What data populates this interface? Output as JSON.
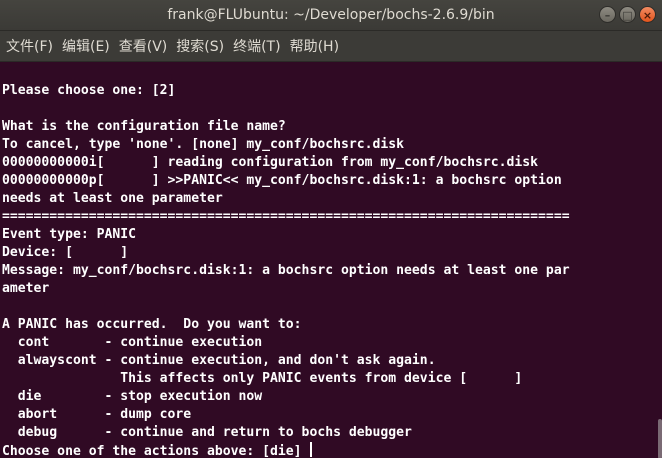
{
  "window": {
    "title": "frank@FLUbuntu: ~/Developer/bochs-2.6.9/bin",
    "buttons": {
      "minimize": "–",
      "maximize": "□",
      "close": "×"
    }
  },
  "menubar": {
    "items": [
      {
        "label": "文件(F)"
      },
      {
        "label": "编辑(E)"
      },
      {
        "label": "查看(V)"
      },
      {
        "label": "搜索(S)"
      },
      {
        "label": "终端(T)"
      },
      {
        "label": "帮助(H)"
      }
    ]
  },
  "terminal": {
    "lines": [
      "",
      "Please choose one: [2]",
      "",
      "What is the configuration file name?",
      "To cancel, type 'none'. [none] my_conf/bochsrc.disk",
      "00000000000i[      ] reading configuration from my_conf/bochsrc.disk",
      "00000000000p[      ] >>PANIC<< my_conf/bochsrc.disk:1: a bochsrc option",
      "needs at least one parameter",
      "========================================================================",
      "Event type: PANIC",
      "Device: [      ]",
      "Message: my_conf/bochsrc.disk:1: a bochsrc option needs at least one par",
      "ameter",
      "",
      "A PANIC has occurred.  Do you want to:",
      "  cont       - continue execution",
      "  alwayscont - continue execution, and don't ask again.",
      "               This affects only PANIC events from device [      ]",
      "  die        - stop execution now",
      "  abort      - dump core",
      "  debug      - continue and return to bochs debugger",
      "Choose one of the actions above: [die] "
    ]
  }
}
